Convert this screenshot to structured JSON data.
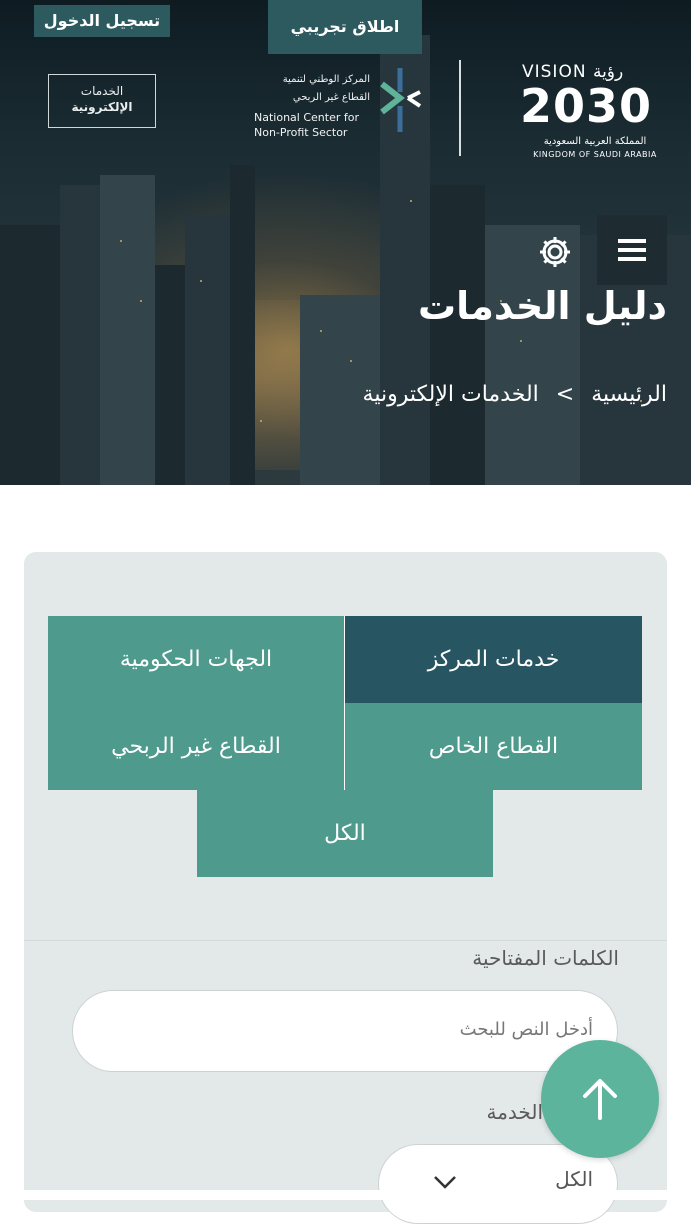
{
  "header": {
    "login_label": "تسجيل الدخول",
    "trial_label": "اطلاق تجريبي",
    "eservices_logo": {
      "line1": "الخدمات",
      "line2": "الإلكترونية"
    },
    "ncnp_logo": {
      "arabic_line1": "المركز الوطني لتنمية",
      "arabic_line2": "القطاع غير الربحي",
      "english_line1": "National Center for",
      "english_line2": "Non-Profit Sector"
    },
    "vision_logo": {
      "word": "VISION",
      "arabic_word": "رؤية",
      "year": "2030",
      "arabic_kingdom": "المملكة العربية السعودية",
      "english_kingdom": "KINGDOM OF SAUDI ARABIA"
    },
    "menu_icon": "hamburger-icon",
    "settings_icon": "gear-icon"
  },
  "page": {
    "title": "دليل الخدمات",
    "breadcrumb": [
      "الرئيسية",
      ">",
      "الخدمات الإلكترونية"
    ]
  },
  "filters": {
    "tabs": [
      {
        "label": "خدمات المركز",
        "active": true
      },
      {
        "label": "الجهات الحكومية",
        "active": false
      },
      {
        "label": "القطاع الخاص",
        "active": false
      },
      {
        "label": "القطاع غير الربحي",
        "active": false
      },
      {
        "label": "الكل",
        "active": false
      }
    ],
    "keywords_label": "الكلمات المفتاحية",
    "search_placeholder": "أدخل النص للبحث",
    "service_label": "الخدمة",
    "service_selected": "الكل"
  },
  "fab_icon": "arrow-up-icon",
  "colors": {
    "tab_green": "#4e9a8c",
    "tab_active": "#275561",
    "header_button": "#2c5a5e",
    "fab": "#5cb49d",
    "card_bg": "#e3e8e8"
  }
}
